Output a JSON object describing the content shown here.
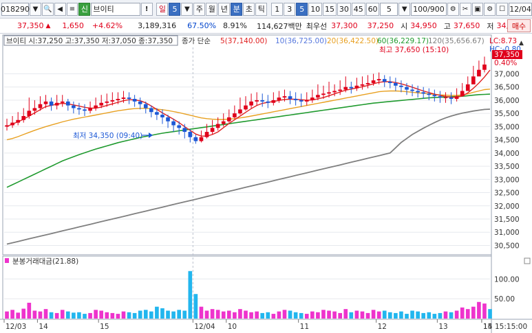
{
  "toolbar": {
    "code": "018290",
    "market_badge": "신",
    "stock_name": "브이티",
    "period_buttons": [
      "일",
      "5",
      "주",
      "월",
      "년",
      "분",
      "초",
      "틱"
    ],
    "number_buttons": [
      "1",
      "3",
      "5",
      "10",
      "15",
      "30",
      "45",
      "60"
    ],
    "interval_value": "5",
    "count_value": "100/900",
    "date_value": "12/04",
    "buy_label": "매수"
  },
  "quote": {
    "price": "37,350",
    "arrow": "▲",
    "change": "1,650",
    "change_pct": "+4.62%",
    "volume": "3,189,316",
    "ratio1": "67.50%",
    "ratio2": "8.91%",
    "amount": "114,627백만",
    "priority_label": "최우선",
    "ask": "37,300",
    "bid": "37,250",
    "open_label": "시",
    "open": "34,950",
    "high_label": "고",
    "high": "37,650",
    "low_label": "저",
    "low": "34,350"
  },
  "legend": {
    "ohlc": "브이티 시:37,250 고:37,350 저:37,050 종:37,350",
    "ma_label": "종가 단순",
    "ma5": "5(37,140.00)",
    "ma10": "10(36,725.00)",
    "ma20": "20(36,422.50)",
    "ma60": "60(36,229.17)",
    "ma120": "120(35,656.67)",
    "lc": "LC:8.73",
    "hc": "HC:-0.80"
  },
  "annotations": {
    "high_note": "최고 37,650 (15:10)",
    "low_note": "최저 34,350 (09:40)",
    "last_price": "37,350",
    "last_pct": "0.40%"
  },
  "volume_panel": {
    "title": "분봉거래대금(21.88)"
  },
  "time_axis": {
    "labels": [
      "12/03",
      "14",
      "15",
      "12/04",
      "10",
      "11",
      "12",
      "13",
      "14",
      "15"
    ],
    "current_time": "15:15:00"
  },
  "colors": {
    "up": "#e0001b",
    "down": "#1c58d6",
    "ma5": "#e02020",
    "ma10": "#5577dd",
    "ma20": "#e8a020",
    "ma60": "#1f9a2e",
    "ma120": "#7f7f7f",
    "vol_up": "#ee33cc",
    "vol_down": "#22b6ee"
  },
  "chart_data": {
    "type": "candlestick",
    "price_ticks": [
      30500,
      31000,
      31500,
      32000,
      32500,
      33000,
      33500,
      34000,
      34500,
      35000,
      35500,
      36000,
      36500,
      37000
    ],
    "ylim": [
      30200,
      38000
    ],
    "volume_ticks": [
      50,
      100
    ],
    "volume_unit": "00",
    "closes": [
      35050,
      35150,
      35250,
      35400,
      35600,
      35700,
      35850,
      35950,
      35800,
      35900,
      35950,
      35800,
      35700,
      35650,
      35600,
      35700,
      35800,
      35900,
      35950,
      36000,
      36050,
      36100,
      36050,
      35950,
      35850,
      35700,
      35550,
      35450,
      35350,
      35200,
      35050,
      34950,
      34800,
      34600,
      34450,
      34600,
      34800,
      34950,
      35100,
      35200,
      35350,
      35500,
      35650,
      35800,
      35950,
      36000,
      35950,
      35900,
      36000,
      36100,
      36150,
      36050,
      36000,
      35950,
      36000,
      36100,
      36200,
      36250,
      36300,
      36350,
      36400,
      36500,
      36450,
      36550,
      36600,
      36650,
      36750,
      36800,
      36700,
      36650,
      36550,
      36500,
      36400,
      36350,
      36300,
      36250,
      36200,
      36150,
      36100,
      36100,
      36050,
      36150,
      36350,
      36600,
      36900,
      37150,
      37350
    ],
    "highs": [
      35300,
      35400,
      35550,
      35700,
      36100,
      36000,
      36150,
      36200,
      36100,
      36200,
      36200,
      36050,
      35950,
      35900,
      35850,
      35950,
      36100,
      36200,
      36250,
      36300,
      36300,
      36350,
      36300,
      36200,
      36100,
      35950,
      35800,
      35700,
      35650,
      35450,
      35300,
      35200,
      35100,
      34900,
      34700,
      34850,
      35100,
      35250,
      35350,
      35500,
      35650,
      35800,
      36100,
      36150,
      36250,
      36300,
      36250,
      36200,
      36300,
      36350,
      36400,
      36350,
      36300,
      36250,
      36300,
      36400,
      36600,
      36550,
      36700,
      36600,
      36750,
      36900,
      36700,
      36850,
      36900,
      36950,
      37000,
      37050,
      36950,
      36900,
      36850,
      36750,
      36650,
      36600,
      36550,
      36500,
      36450,
      36400,
      36350,
      36300,
      36300,
      36450,
      36650,
      36900,
      37300,
      37500,
      37650
    ],
    "lows": [
      34850,
      34950,
      35050,
      35150,
      35300,
      35450,
      35600,
      35700,
      35600,
      35650,
      35750,
      35600,
      35500,
      35450,
      35400,
      35500,
      35600,
      35700,
      35750,
      35800,
      35850,
      35900,
      35850,
      35750,
      35650,
      35500,
      35350,
      35250,
      35100,
      34950,
      34800,
      34700,
      34550,
      34400,
      34350,
      34400,
      34550,
      34700,
      34850,
      35000,
      35150,
      35300,
      35450,
      35600,
      35700,
      35800,
      35750,
      35700,
      35800,
      35900,
      35950,
      35850,
      35800,
      35750,
      35800,
      35900,
      36000,
      36050,
      36100,
      36150,
      36200,
      36300,
      36250,
      36350,
      36400,
      36450,
      36550,
      36600,
      36500,
      36450,
      36350,
      36300,
      36200,
      36150,
      36100,
      36050,
      36000,
      35950,
      35900,
      35900,
      35850,
      35950,
      36150,
      36400,
      36700,
      36950,
      37050
    ],
    "volumes": [
      18,
      22,
      15,
      25,
      40,
      20,
      18,
      24,
      16,
      14,
      22,
      18,
      15,
      16,
      12,
      14,
      22,
      20,
      16,
      14,
      12,
      18,
      16,
      14,
      20,
      22,
      18,
      30,
      26,
      20,
      18,
      22,
      20,
      120,
      62,
      30,
      20,
      24,
      22,
      18,
      20,
      16,
      24,
      20,
      16,
      18,
      14,
      16,
      12,
      18,
      22,
      20,
      16,
      14,
      12,
      18,
      16,
      22,
      20,
      18,
      14,
      24,
      16,
      20,
      18,
      14,
      22,
      18,
      20,
      16,
      14,
      18,
      12,
      20,
      18,
      14,
      16,
      12,
      14,
      18,
      16,
      20,
      28,
      24,
      30,
      42,
      38,
      24
    ],
    "ma5": [
      35000,
      35100,
      35180,
      35280,
      35400,
      35520,
      35640,
      35760,
      35800,
      35850,
      35880,
      35860,
      35820,
      35780,
      35730,
      35700,
      35700,
      35740,
      35800,
      35860,
      35920,
      35980,
      36020,
      36010,
      35980,
      35900,
      35780,
      35650,
      35520,
      35400,
      35280,
      35150,
      35000,
      34860,
      34720,
      34640,
      34640,
      34700,
      34800,
      34960,
      35120,
      35260,
      35400,
      35540,
      35680,
      35800,
      35880,
      35920,
      35950,
      35990,
      36030,
      36040,
      36040,
      36020,
      36000,
      36010,
      36050,
      36100,
      36170,
      36240,
      36310,
      36380,
      36420,
      36460,
      36510,
      36560,
      36620,
      36680,
      36700,
      36700,
      36670,
      36620,
      36560,
      36490,
      36420,
      36350,
      36290,
      36230,
      36180,
      36140,
      36110,
      36110,
      36160,
      36280,
      36450,
      36650,
      36880,
      37140
    ],
    "ma20": [
      34500,
      34550,
      34620,
      34700,
      34780,
      34860,
      34930,
      35000,
      35060,
      35120,
      35180,
      35230,
      35280,
      35320,
      35360,
      35400,
      35440,
      35480,
      35520,
      35560,
      35600,
      35630,
      35660,
      35680,
      35690,
      35690,
      35680,
      35660,
      35640,
      35610,
      35570,
      35530,
      35480,
      35430,
      35380,
      35330,
      35300,
      35280,
      35270,
      35270,
      35280,
      35300,
      35330,
      35360,
      35400,
      35440,
      35480,
      35520,
      35560,
      35600,
      35640,
      35680,
      35720,
      35760,
      35800,
      35840,
      35880,
      35920,
      35960,
      36000,
      36040,
      36080,
      36120,
      36160,
      36200,
      36240,
      36280,
      36320,
      36340,
      36350,
      36350,
      36340,
      36320,
      36300,
      36280,
      36260,
      36240,
      36220,
      36200,
      36190,
      36180,
      36180,
      36200,
      36240,
      36300,
      36350,
      36400,
      36420
    ],
    "ma60": [
      32700,
      32800,
      32900,
      33000,
      33100,
      33200,
      33300,
      33400,
      33500,
      33600,
      33700,
      33780,
      33860,
      33940,
      34010,
      34080,
      34150,
      34210,
      34270,
      34330,
      34390,
      34440,
      34490,
      34540,
      34590,
      34630,
      34670,
      34710,
      34750,
      34780,
      34810,
      34840,
      34870,
      34900,
      34930,
      34960,
      34990,
      35020,
      35050,
      35080,
      35110,
      35140,
      35170,
      35200,
      35230,
      35260,
      35290,
      35320,
      35350,
      35380,
      35410,
      35440,
      35470,
      35500,
      35530,
      35560,
      35590,
      35620,
      35650,
      35680,
      35710,
      35740,
      35770,
      35800,
      35830,
      35860,
      35890,
      35910,
      35930,
      35950,
      35970,
      35990,
      36010,
      36030,
      36050,
      36070,
      36090,
      36100,
      36110,
      36120,
      36130,
      36140,
      36150,
      36170,
      36190,
      36210,
      36220,
      36230
    ],
    "ma120": [
      30550,
      30600,
      30650,
      30700,
      30750,
      30800,
      30850,
      30900,
      30950,
      31000,
      31050,
      31100,
      31150,
      31200,
      31250,
      31300,
      31350,
      31400,
      31450,
      31500,
      31550,
      31600,
      31650,
      31700,
      31750,
      31800,
      31850,
      31900,
      31950,
      32000,
      32050,
      32100,
      32150,
      32200,
      32250,
      32300,
      32350,
      32400,
      32450,
      32500,
      32550,
      32600,
      32650,
      32700,
      32750,
      32800,
      32850,
      32900,
      32950,
      33000,
      33050,
      33100,
      33150,
      33200,
      33250,
      33300,
      33350,
      33400,
      33450,
      33500,
      33550,
      33600,
      33650,
      33700,
      33750,
      33800,
      33850,
      33900,
      33950,
      34000,
      34200,
      34400,
      34550,
      34700,
      34820,
      34940,
      35050,
      35150,
      35250,
      35330,
      35400,
      35460,
      35510,
      35550,
      35590,
      35620,
      35650,
      35660
    ]
  }
}
